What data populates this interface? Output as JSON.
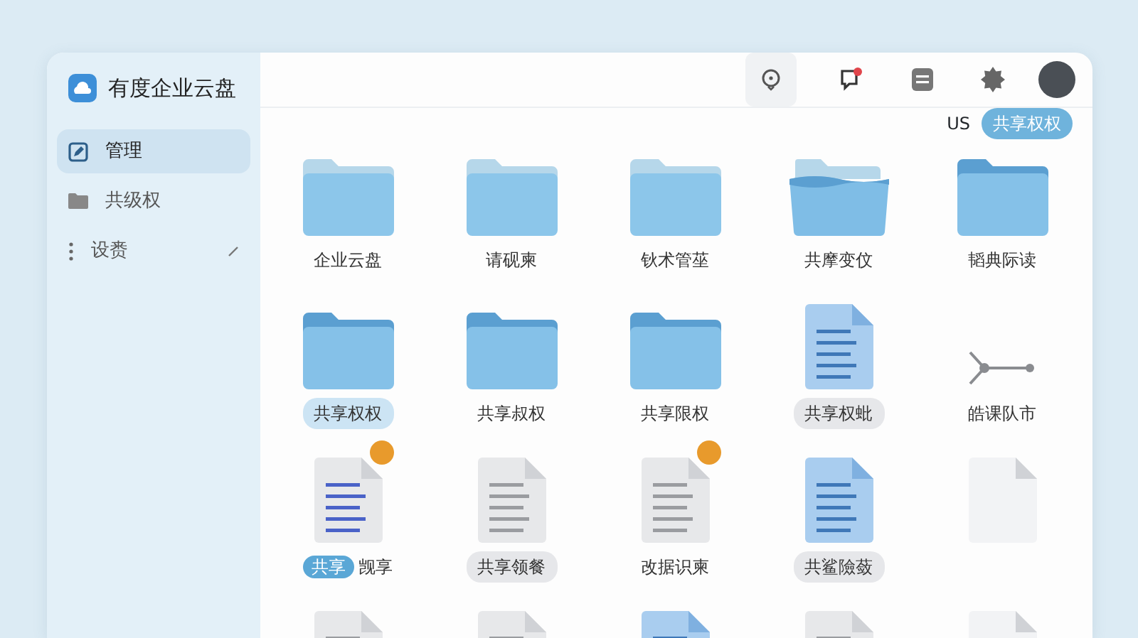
{
  "app": {
    "title": "有度企业云盘"
  },
  "sidebar": {
    "items": [
      {
        "label": "管理",
        "selected": true
      },
      {
        "label": "共级权",
        "selected": false
      },
      {
        "label": "设赉",
        "selected": false,
        "editable": true
      }
    ]
  },
  "toolbar": {
    "notification": true
  },
  "filter": {
    "text": "US",
    "chip": "共享权权"
  },
  "files": [
    {
      "kind": "folder",
      "label": "企业云盘",
      "selected": false,
      "marked": false
    },
    {
      "kind": "folder",
      "label": "请砚柬",
      "selected": false,
      "marked": false
    },
    {
      "kind": "folder",
      "label": "钬术管莝",
      "selected": false,
      "marked": false
    },
    {
      "kind": "folder-open",
      "label": "共摩变伩",
      "selected": false,
      "marked": false
    },
    {
      "kind": "folder-dark",
      "label": "韬典际读",
      "selected": false,
      "marked": false
    },
    {
      "kind": "folder-dark",
      "label": "共享权权",
      "selected": true,
      "marked": false
    },
    {
      "kind": "folder-dark",
      "label": "共享叔权",
      "selected": false,
      "marked": false
    },
    {
      "kind": "folder-dark",
      "label": "共享限权",
      "selected": false,
      "marked": false
    },
    {
      "kind": "doc-blue",
      "label": "共享权蚍",
      "selected": false,
      "marked": true
    },
    {
      "kind": "network",
      "label": "皓课队市",
      "selected": false,
      "marked": false
    },
    {
      "kind": "doc-lines",
      "tag": "共享",
      "label": "觊享",
      "selected": false,
      "marked": false,
      "badge": true
    },
    {
      "kind": "doc",
      "label": "共享领餐",
      "selected": false,
      "marked": true
    },
    {
      "kind": "doc",
      "label": "改据识柬",
      "selected": false,
      "marked": false,
      "badge": true
    },
    {
      "kind": "doc-blue",
      "label": "共鲨險蔹",
      "selected": false,
      "marked": true
    },
    {
      "kind": "doc-blank",
      "selected": false,
      "marked": false
    },
    {
      "kind": "doc",
      "selected": false,
      "marked": false
    },
    {
      "kind": "doc",
      "selected": false,
      "marked": false
    },
    {
      "kind": "doc-blue",
      "selected": false,
      "marked": false
    },
    {
      "kind": "doc",
      "selected": false,
      "marked": false
    },
    {
      "kind": "doc-blank",
      "selected": false,
      "marked": false
    }
  ]
}
